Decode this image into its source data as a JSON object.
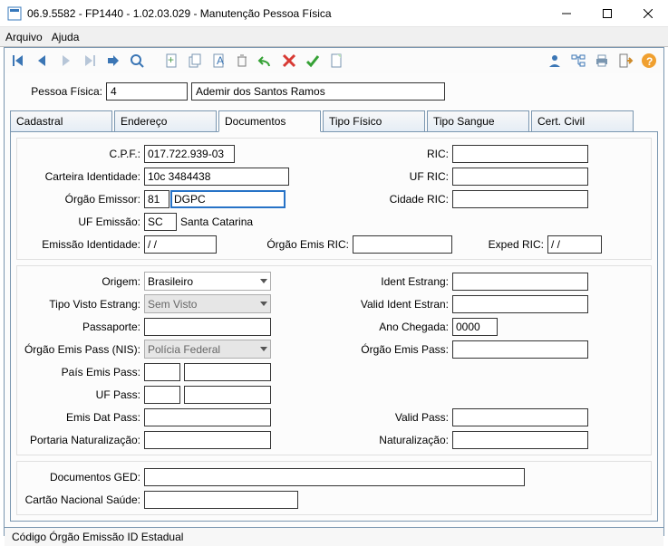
{
  "window": {
    "title": "06.9.5582 - FP1440 - 1.02.03.029 - Manutenção Pessoa Física"
  },
  "menu": {
    "arquivo": "Arquivo",
    "ajuda": "Ajuda"
  },
  "header": {
    "pessoa_label": "Pessoa Física:",
    "pessoa_code": "4",
    "pessoa_name": "Ademir dos Santos Ramos"
  },
  "tabs": {
    "cadastral": "Cadastral",
    "endereco": "Endereço",
    "documentos": "Documentos",
    "tipo_fisico": "Tipo Físico",
    "tipo_sangue": "Tipo Sangue",
    "cert_civil": "Cert. Civil"
  },
  "doc": {
    "cpf_label": "C.P.F.:",
    "cpf": "017.722.939-03",
    "ric_label": "RIC:",
    "ric": "",
    "carteira_ident_label": "Carteira Identidade:",
    "carteira_ident": "10c 3484438",
    "uf_ric_label": "UF RIC:",
    "uf_ric": "",
    "orgao_emissor_label": "Órgão Emissor:",
    "orgao_emissor_code": "81",
    "orgao_emissor_name": "DGPC",
    "cidade_ric_label": "Cidade RIC:",
    "cidade_ric": "",
    "uf_emissao_label": "UF Emissão:",
    "uf_emissao_code": "SC",
    "uf_emissao_name": "Santa Catarina",
    "emissao_ident_label": "Emissão Identidade:",
    "emissao_ident": "  /  /",
    "orgao_emis_ric_label": "Órgão Emis RIC:",
    "orgao_emis_ric": "",
    "exped_ric_label": "Exped RIC:",
    "exped_ric": "  /  /",
    "origem_label": "Origem:",
    "origem": "Brasileiro",
    "ident_estrang_label": "Ident Estrang:",
    "ident_estrang": "",
    "tipo_visto_label": "Tipo Visto Estrang:",
    "tipo_visto": "Sem Visto",
    "valid_ident_estran_label": "Valid Ident Estran:",
    "valid_ident_estran": "",
    "passaporte_label": "Passaporte:",
    "passaporte": "",
    "ano_chegada_label": "Ano Chegada:",
    "ano_chegada": "0000",
    "orgao_emis_pass_nis_label": "Órgão Emis Pass (NIS):",
    "orgao_emis_pass_nis": "Polícia Federal",
    "orgao_emis_pass_label": "Órgão Emis Pass:",
    "orgao_emis_pass": "",
    "pais_emis_pass_label": "País Emis Pass:",
    "pais_emis_pass_code": "",
    "pais_emis_pass_name": "",
    "uf_pass_label": "UF Pass:",
    "uf_pass_code": "",
    "uf_pass_name": "",
    "emis_dat_pass_label": "Emis Dat Pass:",
    "emis_dat_pass": "",
    "valid_pass_label": "Valid Pass:",
    "valid_pass": "",
    "port_natur_label": "Portaria Naturalização:",
    "port_natur": "",
    "naturalizacao_label": "Naturalização:",
    "naturalizacao": "",
    "doc_ged_label": "Documentos GED:",
    "doc_ged": "",
    "cns_label": "Cartão Nacional Saúde:",
    "cns": ""
  },
  "status": "Código Órgão Emissão ID Estadual"
}
